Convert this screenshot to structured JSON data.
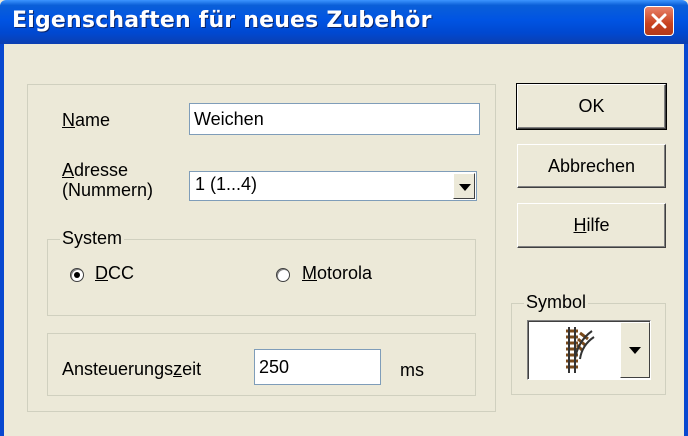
{
  "window": {
    "title": "Eigenschaften für neues Zubehör",
    "close_glyph": "close-icon"
  },
  "name_field": {
    "label_accel": "N",
    "label_rest": "ame",
    "value": "Weichen"
  },
  "address_field": {
    "label_line1_accel": "A",
    "label_line1_rest": "dresse",
    "label_line2": "(Nummern)",
    "selected": "1   (1...4)"
  },
  "system_group": {
    "title": "System",
    "options": [
      {
        "accel": "D",
        "rest": "CC",
        "checked": true
      },
      {
        "accel": "M",
        "rest": "otorola",
        "checked": false
      }
    ]
  },
  "timing_field": {
    "label_pre": "Ansteuerungs",
    "label_accel": "z",
    "label_post": "eit",
    "value": "250",
    "unit": "ms"
  },
  "buttons": {
    "ok": "OK",
    "cancel": "Abbrechen",
    "help_accel": "H",
    "help_rest": "ilfe"
  },
  "symbol_group": {
    "title": "Symbol",
    "icon": "turnout-track-icon"
  },
  "colors": {
    "titlebar": "#0054e3",
    "close_button": "#c8421f",
    "dialog_background": "#ece9d8"
  }
}
